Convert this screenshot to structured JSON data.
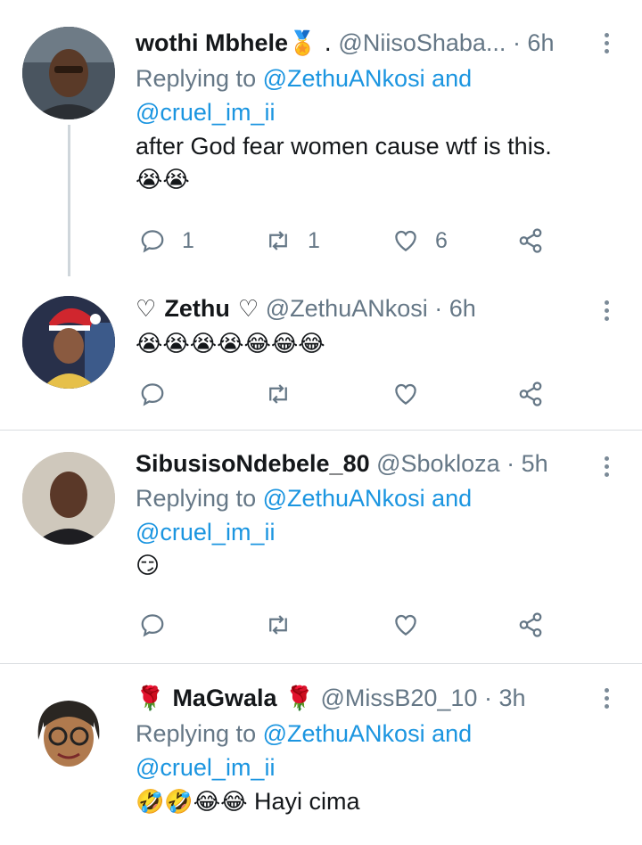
{
  "tweets": [
    {
      "name": "wothi Mbhele",
      "name_suffix": "🏅 .",
      "handle": "@NiisoShaba...",
      "time": "· 6h",
      "reply_prefix": "Replying to ",
      "reply_user1": "@ZethuANkosi",
      "reply_and": " and",
      "reply_user2": "@cruel_im_ii",
      "text": "after God fear women cause wtf is this.",
      "emoji": "😭😭",
      "replies": "1",
      "retweets": "1",
      "likes": "6"
    },
    {
      "name_prefix": "♡ ",
      "name": "Zethu",
      "name_suffix": " ♡",
      "handle": "@ZethuANkosi",
      "time": "· 6h",
      "emoji": "😭😭😭😭😂😂😂",
      "replies": "",
      "retweets": "",
      "likes": ""
    },
    {
      "name": "SibusisoNdebele_80",
      "handle": "@Sbokloza",
      "time": "· 5h",
      "reply_prefix": "Replying to ",
      "reply_user1": "@ZethuANkosi",
      "reply_and": " and",
      "reply_user2": "@cruel_im_ii",
      "emoji": "😏",
      "replies": "",
      "retweets": "",
      "likes": ""
    },
    {
      "name_prefix": "🌹 ",
      "name": "MaGwala",
      "name_suffix": " 🌹",
      "handle": "@MissB20_10",
      "time": "· 3h",
      "reply_prefix": "Replying to ",
      "reply_user1": "@ZethuANkosi",
      "reply_and": " and",
      "reply_user2": "@cruel_im_ii",
      "emoji": "🤣🤣😂😂",
      "text": "Hayi cima"
    }
  ],
  "icons": {
    "reply": "reply-icon",
    "retweet": "retweet-icon",
    "like": "heart-icon",
    "share": "share-icon",
    "more": "more-vertical-icon"
  },
  "colors": {
    "link": "#1b95e0",
    "muted": "#657786",
    "text": "#14171a"
  }
}
